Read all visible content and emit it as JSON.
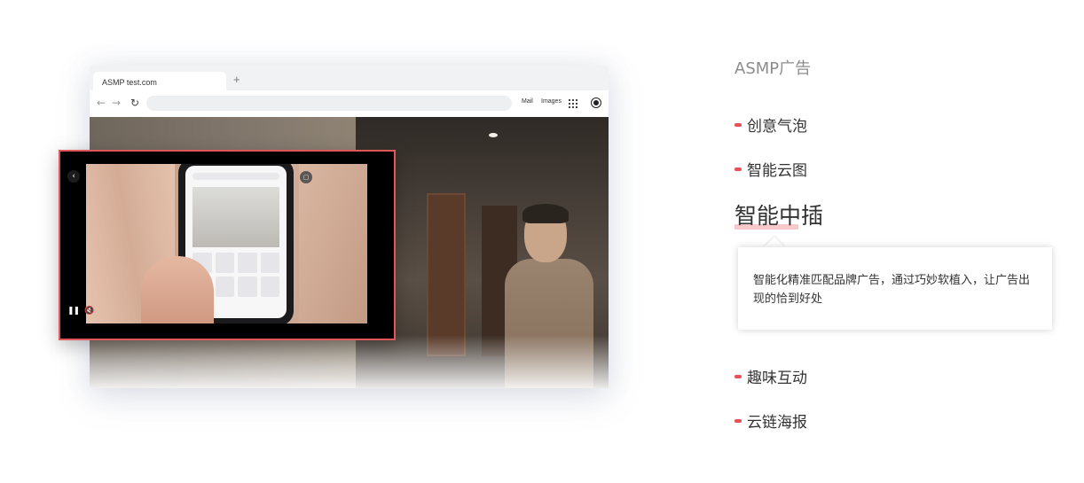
{
  "browser": {
    "tab_title": "ASMP test.com",
    "new_tab_icon": "plus",
    "nav_back_icon": "arrow-left",
    "nav_forward_icon": "arrow-right",
    "reload_icon": "reload",
    "link_mail": "Mail",
    "link_images": "Images",
    "apps_icon": "grid",
    "account_icon": "avatar"
  },
  "midroll": {
    "back_icon": "chevron-left",
    "tv_icon": "tv",
    "pause_icon": "pause",
    "mute_icon": "speaker-mute",
    "border_color": "#e0575b"
  },
  "panel": {
    "title": "ASMP广告",
    "items": [
      {
        "label": "创意气泡"
      },
      {
        "label": "智能云图"
      },
      {
        "label": "智能中插"
      },
      {
        "label": "趣味互动"
      },
      {
        "label": "云链海报"
      }
    ],
    "active_index": 2,
    "description": "智能化精准匹配品牌广告，通过巧妙软植入，让广告出现的恰到好处",
    "accent_color": "#ea4f56"
  }
}
